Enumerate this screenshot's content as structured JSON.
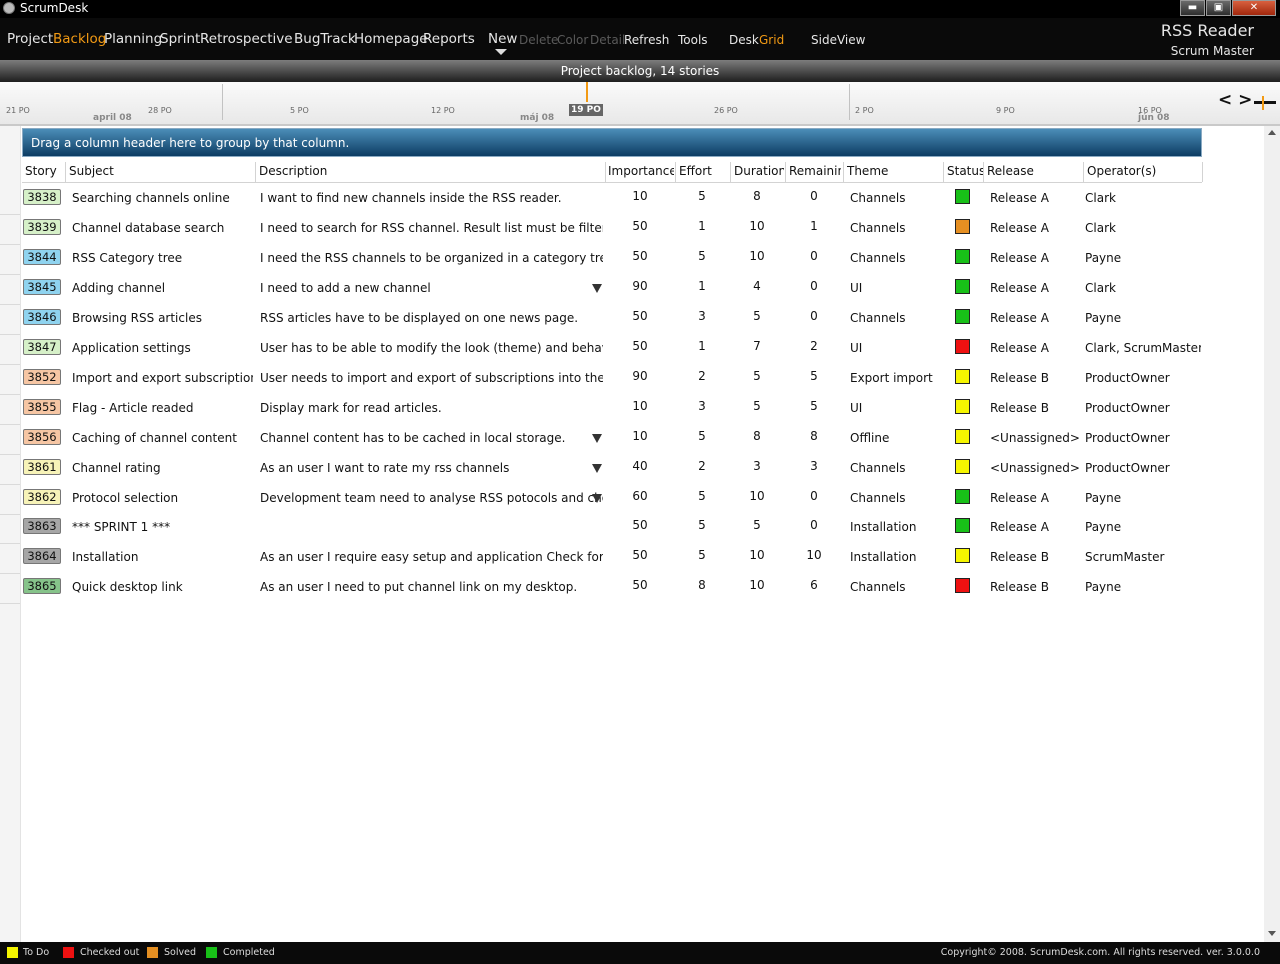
{
  "app": {
    "title": "ScrumDesk"
  },
  "window_buttons": {
    "minimize": "▬",
    "maximize": "▣",
    "close": "✕"
  },
  "menu": {
    "items": [
      "Project",
      "Backlog",
      "Planning",
      "Sprint",
      "Retrospective",
      "BugTrack",
      "Homepage",
      "Reports",
      "New",
      "Delete",
      "Color",
      "Detail",
      "Refresh",
      "Tools",
      "Desk",
      "Grid",
      "SideView"
    ],
    "active": [
      "Backlog",
      "Grid"
    ]
  },
  "project": {
    "name": "RSS Reader",
    "role": "Scrum Master"
  },
  "status_text": "Project backlog,  14 stories",
  "timeline": {
    "dates": [
      "21 PO",
      "28 PO",
      "5 PO",
      "12 PO",
      "19 PO",
      "26 PO",
      "2 PO",
      "9 PO",
      "16 PO"
    ],
    "months": [
      "april 08",
      "máj 08",
      "jún 08"
    ],
    "today": "19 PO",
    "nav": "< >"
  },
  "group_hint": "Drag a column header here to group by that column.",
  "columns": [
    "Story",
    "Subject",
    "Description",
    "Importance",
    "Effort",
    "Duration",
    "Remainin",
    "Theme",
    "Status",
    "Release",
    "Operator(s)"
  ],
  "stories": [
    {
      "id": "3838",
      "subject": "Searching channels online",
      "description": "I want  to find new channels inside the RSS reader.",
      "importance": "10",
      "effort": "5",
      "duration": "8",
      "remaining": "0",
      "theme": "Channels",
      "status": "Completed",
      "release": "Release A",
      "operators": "Clark",
      "color": "#d6f0c8",
      "dropdown": false
    },
    {
      "id": "3839",
      "subject": "Channel database search",
      "description": "I need to search for RSS channel. Result list must be filtered while",
      "importance": "50",
      "effort": "1",
      "duration": "10",
      "remaining": "1",
      "theme": "Channels",
      "status": "Solved",
      "release": "Release A",
      "operators": "Clark",
      "color": "#d6f0c8",
      "dropdown": false
    },
    {
      "id": "3844",
      "subject": "RSS Category tree",
      "description": "I need the RSS channels to be organized in a category tree",
      "importance": "50",
      "effort": "5",
      "duration": "10",
      "remaining": "0",
      "theme": "Channels",
      "status": "Completed",
      "release": "Release A",
      "operators": "Payne",
      "color": "#8fd3ef",
      "dropdown": false
    },
    {
      "id": "3845",
      "subject": "Adding channel",
      "description": "I need  to add a new channel",
      "importance": "90",
      "effort": "1",
      "duration": "4",
      "remaining": "0",
      "theme": "UI",
      "status": "Completed",
      "release": "Release A",
      "operators": "Clark",
      "color": "#8fd3ef",
      "dropdown": true
    },
    {
      "id": "3846",
      "subject": "Browsing RSS articles",
      "description": "RSS articles have to be displayed on one news page.",
      "importance": "50",
      "effort": "3",
      "duration": "5",
      "remaining": "0",
      "theme": "Channels",
      "status": "Completed",
      "release": "Release A",
      "operators": "Payne",
      "color": "#8fd3ef",
      "dropdown": false
    },
    {
      "id": "3847",
      "subject": "Application settings",
      "description": "User has to be able to modify the look (theme) and behavior of t",
      "importance": "50",
      "effort": "1",
      "duration": "7",
      "remaining": "2",
      "theme": "UI",
      "status": "Checked out",
      "release": "Release A",
      "operators": "Clark, ScrumMaster",
      "color": "#d6f0c8",
      "dropdown": false
    },
    {
      "id": "3852",
      "subject": "Import and export subscription lis",
      "description": "User needs to import and export of subscriptions into the file (in",
      "importance": "90",
      "effort": "2",
      "duration": "5",
      "remaining": "5",
      "theme": "Export import",
      "status": "To Do",
      "release": "Release B",
      "operators": "ProductOwner",
      "color": "#f6c6a4",
      "dropdown": false
    },
    {
      "id": "3855",
      "subject": "Flag - Article readed",
      "description": "Display mark for read articles.",
      "importance": "10",
      "effort": "3",
      "duration": "5",
      "remaining": "5",
      "theme": "UI",
      "status": "To Do",
      "release": "Release B",
      "operators": "ProductOwner",
      "color": "#f6c6a4",
      "dropdown": false
    },
    {
      "id": "3856",
      "subject": "Caching of channel content",
      "description": "Channel content has to be cached in local storage.",
      "importance": "10",
      "effort": "5",
      "duration": "8",
      "remaining": "8",
      "theme": "Offline",
      "status": "To Do",
      "release": "<Unassigned>",
      "operators": "ProductOwner",
      "color": "#f6c6a4",
      "dropdown": true
    },
    {
      "id": "3861",
      "subject": "Channel rating",
      "description": "As an user I want to rate my rss channels",
      "importance": "40",
      "effort": "2",
      "duration": "3",
      "remaining": "3",
      "theme": "Channels",
      "status": "To Do",
      "release": "<Unassigned>",
      "operators": "ProductOwner",
      "color": "#f7f3b8",
      "dropdown": true
    },
    {
      "id": "3862",
      "subject": "Protocol selection",
      "description": "Development team need to analyse RSS potocols and choose su",
      "importance": "60",
      "effort": "5",
      "duration": "10",
      "remaining": "0",
      "theme": "Channels",
      "status": "Completed",
      "release": "Release A",
      "operators": "Payne",
      "color": "#f7f3b8",
      "dropdown": true
    },
    {
      "id": "3863",
      "subject": "*** SPRINT 1 ***",
      "description": "",
      "importance": "50",
      "effort": "5",
      "duration": "5",
      "remaining": "0",
      "theme": "Installation",
      "status": "Completed",
      "release": "Release A",
      "operators": "Payne",
      "color": "#a6a6a6",
      "dropdown": false
    },
    {
      "id": "3864",
      "subject": "Installation",
      "description": "As an user I require easy setup and application Check for update",
      "importance": "50",
      "effort": "5",
      "duration": "10",
      "remaining": "10",
      "theme": "Installation",
      "status": "To Do",
      "release": "Release B",
      "operators": "ScrumMaster",
      "color": "#a6a6a6",
      "dropdown": false
    },
    {
      "id": "3865",
      "subject": "Quick desktop link",
      "description": "As an user I need to put channel link on my desktop.",
      "importance": "50",
      "effort": "8",
      "duration": "10",
      "remaining": "6",
      "theme": "Channels",
      "status": "Checked out",
      "release": "Release B",
      "operators": "Payne",
      "color": "#86c38a",
      "dropdown": false
    }
  ],
  "status_colors": {
    "To Do": "#f5f500",
    "Checked out": "#ee1111",
    "Solved": "#e58f22",
    "Completed": "#18c018"
  },
  "legend": [
    {
      "label": "To Do",
      "color": "#f5f500"
    },
    {
      "label": "Checked out",
      "color": "#ee1111"
    },
    {
      "label": "Solved",
      "color": "#e58f22"
    },
    {
      "label": "Completed",
      "color": "#18c018"
    }
  ],
  "copyright": "Copyright© 2008. ScrumDesk.com. All rights reserved. ver. 3.0.0.0"
}
